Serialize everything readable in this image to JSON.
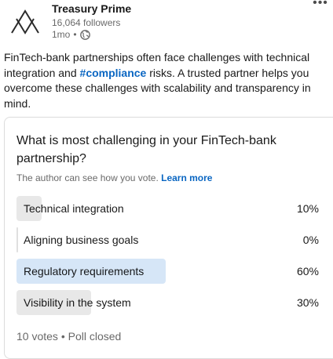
{
  "author": {
    "name": "Treasury Prime",
    "followers": "16,064 followers",
    "time": "1mo",
    "separator": "•",
    "visibility_icon": "globe-icon",
    "logo_icon": "triangle-logo"
  },
  "post": {
    "text_before": "FinTech-bank partnerships often face challenges with technical integration and ",
    "hashtag": "#compliance",
    "text_after": " risks. A trusted partner helps you overcome these challenges with scalability and transparency in mind."
  },
  "poll": {
    "question": "What is most challenging in your FinTech-bank partnership?",
    "disclaimer": "The author can see how you vote.",
    "learn_more": "Learn more",
    "options": [
      {
        "label": "Technical integration",
        "percent_text": "10%",
        "percent": 10,
        "selected": false
      },
      {
        "label": "Aligning business goals",
        "percent_text": "0%",
        "percent": 0,
        "selected": false
      },
      {
        "label": "Regulatory requirements",
        "percent_text": "60%",
        "percent": 60,
        "selected": true
      },
      {
        "label": "Visibility in the system",
        "percent_text": "30%",
        "percent": 30,
        "selected": false
      }
    ],
    "footer": "10 votes • Poll closed"
  },
  "colors": {
    "link": "#0a66c2",
    "bar": "#e8e8e8",
    "bar_selected": "#d6e6f7"
  }
}
